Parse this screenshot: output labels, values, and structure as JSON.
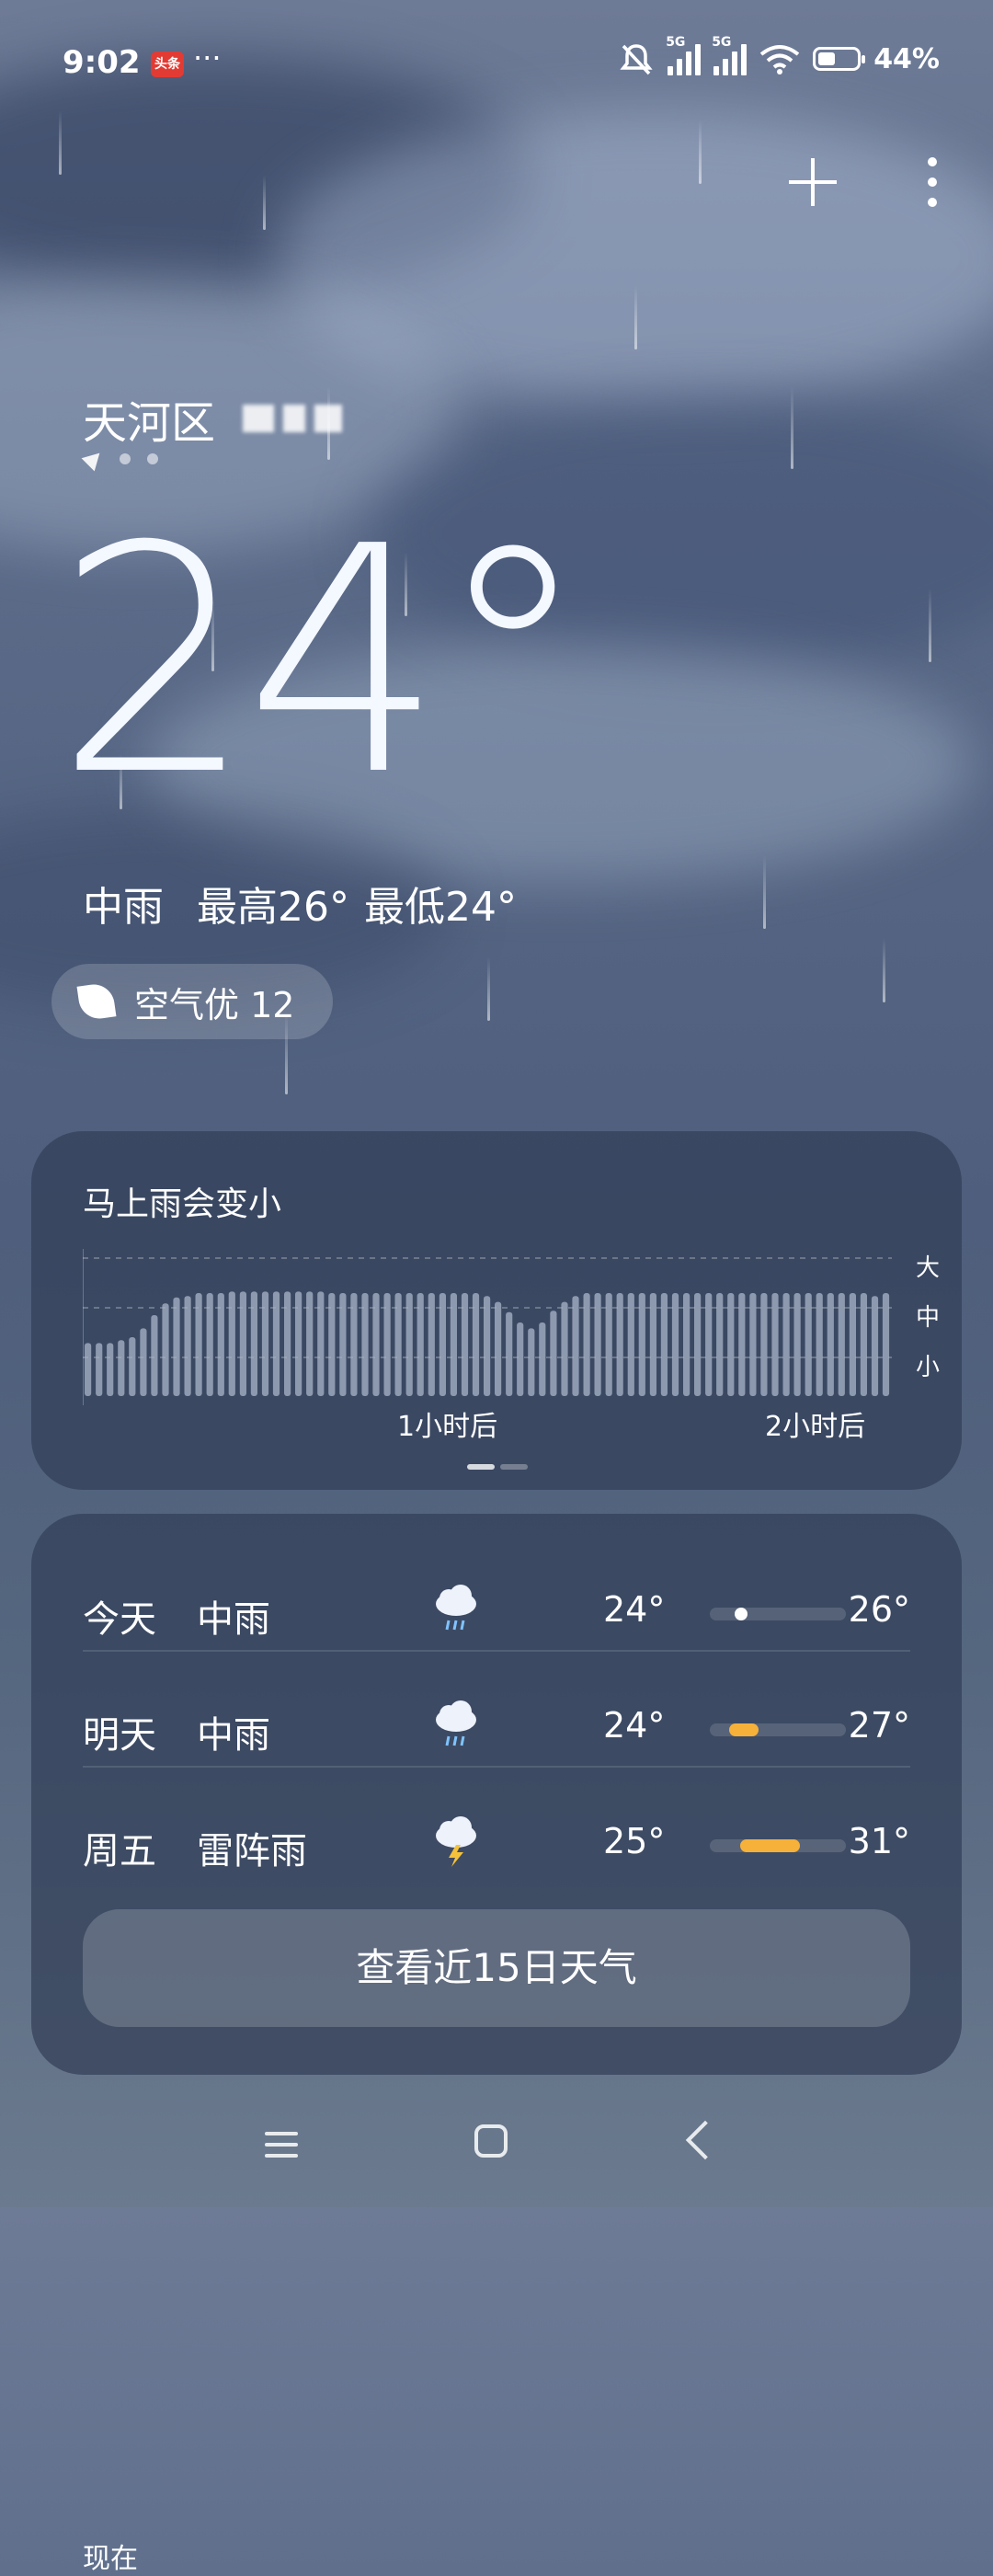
{
  "status_bar": {
    "time": "9:02",
    "app_badge": "头条",
    "more_indicator": "···",
    "icons": [
      "mute-icon",
      "signal-5g-icon",
      "signal-5g-icon",
      "wifi-icon",
      "battery-icon"
    ],
    "network_1": "5G",
    "network_2": "5G",
    "battery_percent": 44,
    "battery_text": "44%"
  },
  "header": {
    "add_icon": "plus-icon",
    "menu_icon": "more-vertical-icon"
  },
  "location": {
    "district": "天河区"
  },
  "current": {
    "temperature": "24°",
    "condition": "中雨",
    "high": "最高26°",
    "low": "最低24°",
    "aqi_label": "空气优 12"
  },
  "rain_card": {
    "title": "马上雨会变小",
    "y_labels": [
      "大",
      "中",
      "小"
    ],
    "x_labels": [
      "现在",
      "1小时后",
      "2小时后"
    ]
  },
  "chart_data": {
    "type": "bar",
    "title": "马上雨会变小",
    "y_levels": [
      "小",
      "中",
      "大"
    ],
    "x_ticks": [
      "现在",
      "1小时后",
      "2小时后"
    ],
    "values": [
      0.36,
      0.36,
      0.36,
      0.38,
      0.4,
      0.46,
      0.55,
      0.63,
      0.67,
      0.68,
      0.7,
      0.7,
      0.7,
      0.71,
      0.71,
      0.71,
      0.71,
      0.71,
      0.71,
      0.71,
      0.71,
      0.71,
      0.7,
      0.7,
      0.7,
      0.7,
      0.7,
      0.7,
      0.7,
      0.7,
      0.7,
      0.7,
      0.7,
      0.7,
      0.7,
      0.7,
      0.68,
      0.64,
      0.57,
      0.5,
      0.46,
      0.5,
      0.58,
      0.64,
      0.68,
      0.7,
      0.7,
      0.7,
      0.7,
      0.7,
      0.7,
      0.7,
      0.7,
      0.7,
      0.7,
      0.7,
      0.7,
      0.7,
      0.7,
      0.7,
      0.7,
      0.7,
      0.7,
      0.7,
      0.7,
      0.7,
      0.7,
      0.7,
      0.7,
      0.7,
      0.7,
      0.68,
      0.7
    ]
  },
  "forecast": [
    {
      "day": "今天",
      "desc": "中雨",
      "icon": "rain-cloud-icon",
      "low": "24°",
      "high": "26°",
      "range_start": 0.18,
      "range_end": 0.26,
      "dot": true,
      "bar_color": "#ffffff"
    },
    {
      "day": "明天",
      "desc": "中雨",
      "icon": "rain-cloud-icon",
      "low": "24°",
      "high": "27°",
      "range_start": 0.14,
      "range_end": 0.36,
      "dot": false,
      "bar_color": "#f5b13a"
    },
    {
      "day": "周五",
      "desc": "雷阵雨",
      "icon": "thunderstorm-icon",
      "low": "25°",
      "high": "31°",
      "range_start": 0.22,
      "range_end": 0.66,
      "dot": false,
      "bar_color": "#f5b13a"
    }
  ],
  "forecast_button": "查看近15日天气",
  "nav": {
    "menu_icon": "menu-icon",
    "home_icon": "home-icon",
    "back_icon": "back-icon"
  }
}
